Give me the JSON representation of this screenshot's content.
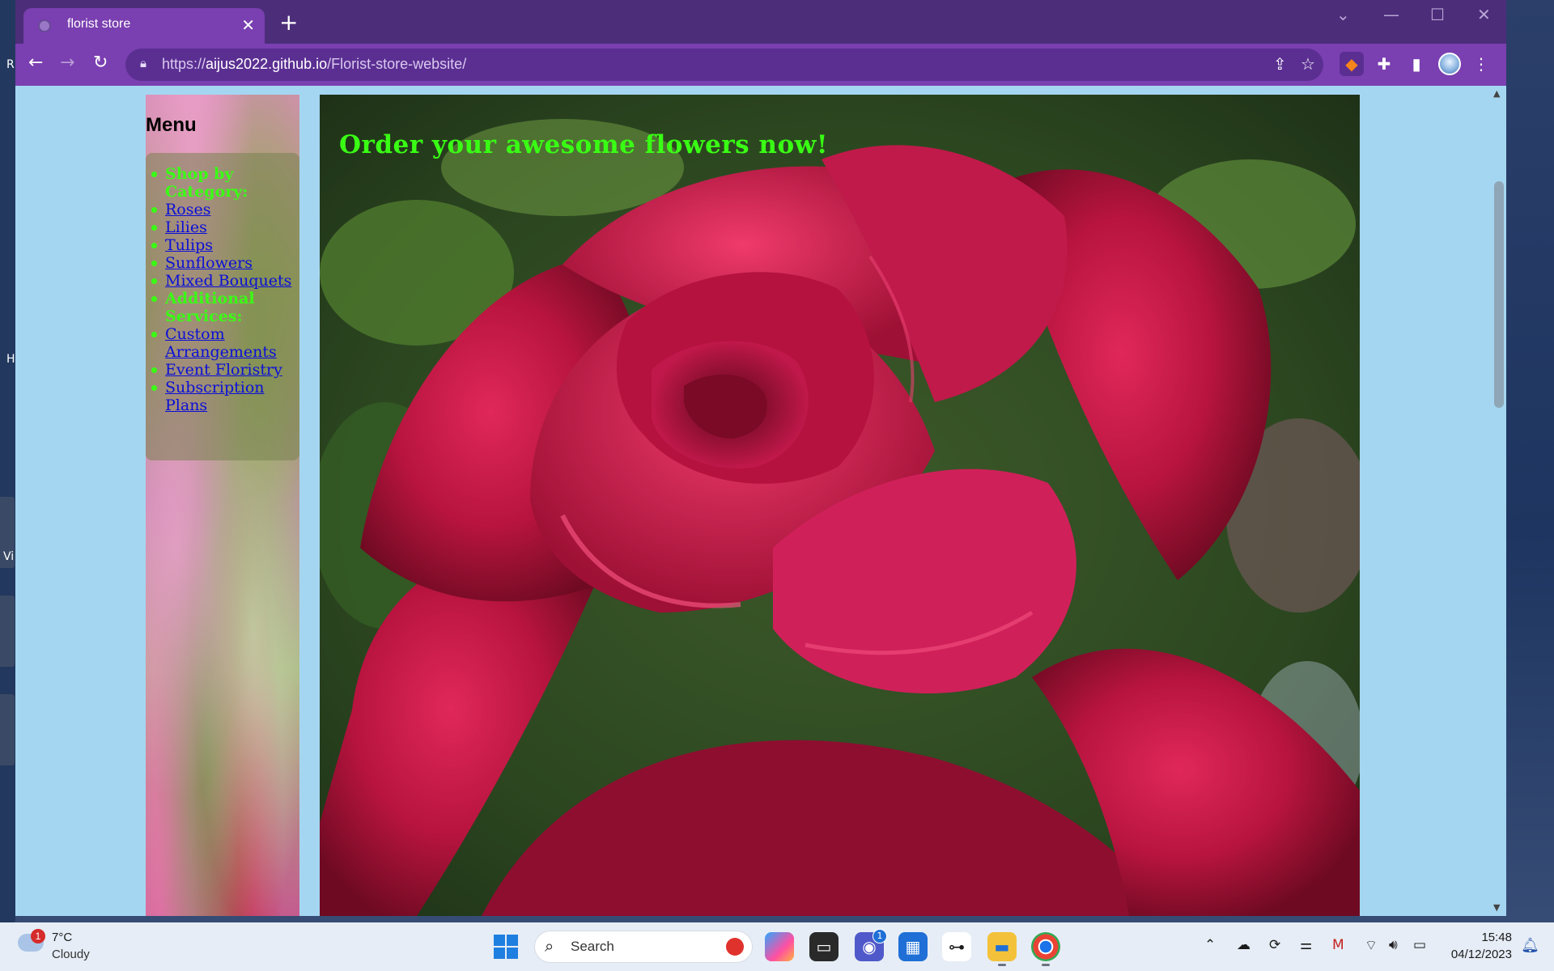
{
  "desktop": {
    "frag_text_1": "R",
    "frag_text_2": "Vi",
    "frag_text_3": "H"
  },
  "browser": {
    "tab": {
      "title": "florist store",
      "close": "✕"
    },
    "new_tab": "+",
    "window_controls": {
      "tab_search": "⌄",
      "minimize": "—",
      "maximize": "☐",
      "close": "✕"
    },
    "nav": {
      "back": "←",
      "forward": "→",
      "reload": "↻"
    },
    "address": {
      "scheme": "https://",
      "host": "aijus2022.github.io",
      "path": "/Florist-store-website/",
      "lock_icon": "lock-icon"
    },
    "toolbar_icons": [
      "share-icon",
      "bookmark-star-icon",
      "metamask-extension-icon",
      "extensions-puzzle-icon",
      "side-panel-icon",
      "profile-avatar",
      "more-menu-icon"
    ],
    "theme_color": "#7a3fb0",
    "tab_strip_color": "#4c2d7a"
  },
  "page": {
    "background_color": "#a5d6f1",
    "menu": {
      "heading": "Menu",
      "items": [
        {
          "label": "Shop by Category:",
          "type": "category"
        },
        {
          "label": "Roses",
          "type": "link"
        },
        {
          "label": "Lilies",
          "type": "link"
        },
        {
          "label": "Tulips",
          "type": "link"
        },
        {
          "label": "Sunflowers",
          "type": "link"
        },
        {
          "label": "Mixed Bouquets",
          "type": "link"
        },
        {
          "label": "Additional Services:",
          "type": "category"
        },
        {
          "label": "Custom Arrangements",
          "type": "link"
        },
        {
          "label": "Event Floristry",
          "type": "link"
        },
        {
          "label": "Subscription Plans",
          "type": "link"
        }
      ],
      "category_color": "#39ff14",
      "link_color": "#0a0fd8"
    },
    "hero": {
      "title": "Order your awesome flowers now!",
      "title_color": "#39ff14",
      "image_subject": "red rose"
    }
  },
  "taskbar": {
    "weather": {
      "badge": "1",
      "temperature": "7°C",
      "condition": "Cloudy"
    },
    "search_label": "Search",
    "apps": [
      {
        "name": "copilot",
        "badge": ""
      },
      {
        "name": "task-view",
        "badge": ""
      },
      {
        "name": "teams-chat",
        "badge": "1"
      },
      {
        "name": "microsoft-store",
        "badge": ""
      },
      {
        "name": "app-connect",
        "badge": ""
      },
      {
        "name": "file-explorer",
        "badge": ""
      },
      {
        "name": "chrome",
        "badge": ""
      }
    ],
    "clock": {
      "time": "15:48",
      "date": "04/12/2023"
    }
  }
}
